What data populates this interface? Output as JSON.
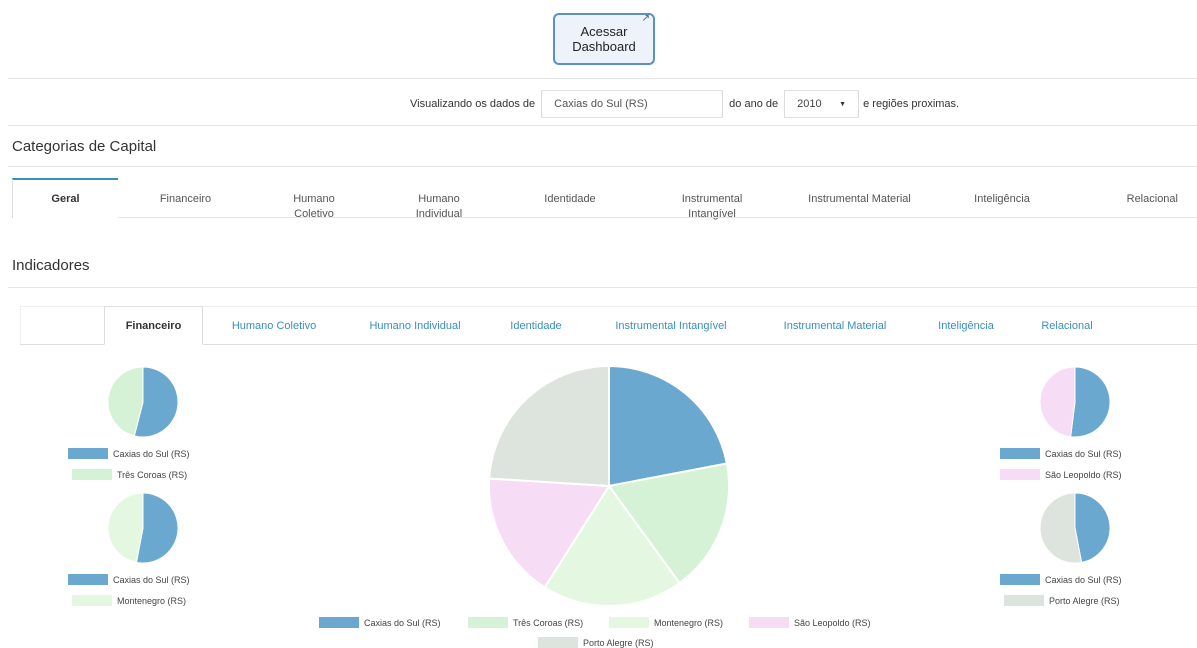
{
  "dashboard_button": {
    "label_line1": "Acessar",
    "label_line2": "Dashboard",
    "icon": "external-link-icon"
  },
  "filter": {
    "prefix": "Visualizando os dados de",
    "city": "Caxias do Sul (RS)",
    "middle": "do ano de",
    "year": "2010",
    "suffix": "e regiões proximas."
  },
  "capital": {
    "title": "Categorias de Capital",
    "tabs": [
      {
        "line1": "Geral",
        "line2": ""
      },
      {
        "line1": "Financeiro",
        "line2": ""
      },
      {
        "line1": "Humano",
        "line2": "Coletivo"
      },
      {
        "line1": "Humano",
        "line2": "Individual"
      },
      {
        "line1": "Identidade",
        "line2": ""
      },
      {
        "line1": "Instrumental",
        "line2": "Intangível"
      },
      {
        "line1": "Instrumental Material",
        "line2": ""
      },
      {
        "line1": "Inteligência",
        "line2": ""
      },
      {
        "line1": "Relacional",
        "line2": ""
      }
    ]
  },
  "indicators": {
    "title": "Indicadores",
    "tabs": [
      "Financeiro",
      "Humano Coletivo",
      "Humano Individual",
      "Identidade",
      "Instrumental Intangível",
      "Instrumental Material",
      "Inteligência",
      "Relacional"
    ]
  },
  "colors": {
    "caxias": "#6aa8d0",
    "tres_coroas": "#d6f2d6",
    "montenegro": "#e4f8e1",
    "sao_leopoldo": "#f6dcf4",
    "porto_alegre": "#dde3dd"
  },
  "chart_data": [
    {
      "type": "pie",
      "labels": [
        "Caxias do Sul (RS)",
        "Três Coroas (RS)"
      ],
      "values": [
        54,
        46
      ]
    },
    {
      "type": "pie",
      "labels": [
        "Caxias do Sul (RS)",
        "Montenegro (RS)"
      ],
      "values": [
        53,
        47
      ]
    },
    {
      "type": "pie",
      "labels": [
        "Caxias do Sul (RS)",
        "Três Coroas (RS)",
        "Montenegro (RS)",
        "São Leopoldo (RS)",
        "Porto Alegre (RS)"
      ],
      "values": [
        22,
        18,
        19,
        17,
        24
      ]
    },
    {
      "type": "pie",
      "labels": [
        "Caxias do Sul (RS)",
        "São Leopoldo (RS)"
      ],
      "values": [
        52,
        48
      ]
    },
    {
      "type": "pie",
      "labels": [
        "Caxias do Sul (RS)",
        "Porto Alegre (RS)"
      ],
      "values": [
        47,
        53
      ]
    }
  ]
}
